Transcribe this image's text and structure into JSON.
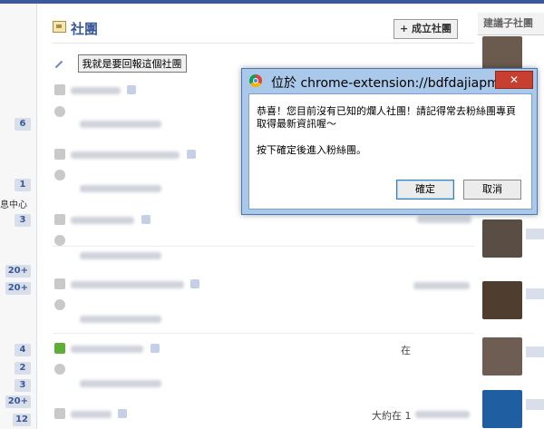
{
  "header": {
    "title": "社團",
    "create_button": "+ 成立社團",
    "suggest_title": "建議子社團"
  },
  "left_badges": [
    "6",
    "1",
    "3",
    "20+",
    "20+",
    "4",
    "2",
    "3",
    "20+",
    "12"
  ],
  "left_fragment": "息中心",
  "report_button": "我就是要回報這個社團",
  "fragments": {
    "time_a": "在",
    "time_b": "大約在 1"
  },
  "dialog": {
    "title": "位於 chrome-extension://bdfdajiapmgbjn...",
    "close": "✕",
    "message_line1": "恭喜！您目前沒有已知的爛人社團！請記得常去粉絲團專頁取得最新資訊喔～",
    "message_line2": "按下確定後進入粉絲團。",
    "ok": "確定",
    "cancel": "取消"
  },
  "colors": {
    "accent": "#3b5998",
    "dialog_frame": "#aac8ea",
    "close_red": "#c7402f"
  }
}
